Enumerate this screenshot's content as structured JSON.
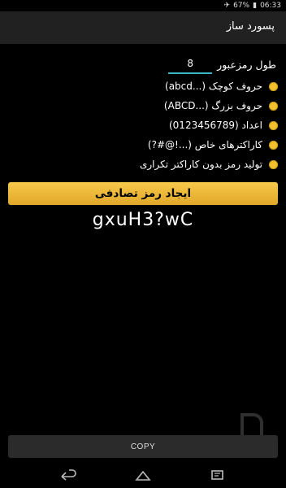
{
  "status": {
    "signal_icon": "signal-icon",
    "wifi_icon": "wifi-icon",
    "airplane_icon": "airplane-icon",
    "battery_text": "67%",
    "battery_icon": "battery-icon",
    "time": "06:33"
  },
  "appbar": {
    "title": "پسورد ساز"
  },
  "length": {
    "label": "طول رمزعبور",
    "value": "8"
  },
  "options": [
    {
      "label": "حروف کوچک (...abcd)",
      "checked": true
    },
    {
      "label": "حروف بزرگ (...ABCD)",
      "checked": true
    },
    {
      "label": "اعداد (0123456789)",
      "checked": true
    },
    {
      "label": "کاراکترهای خاص (...!@#?)",
      "checked": true
    },
    {
      "label": "تولید رمز بدون کاراکتر تکراری",
      "checked": true
    }
  ],
  "generate_button": "ایجاد رمز تصادفی",
  "result": "gxuH3?wC",
  "copy_button": "COPY",
  "colors": {
    "accent": "#f2c12e",
    "input_underline": "#3bb5c4",
    "background": "#000000"
  }
}
